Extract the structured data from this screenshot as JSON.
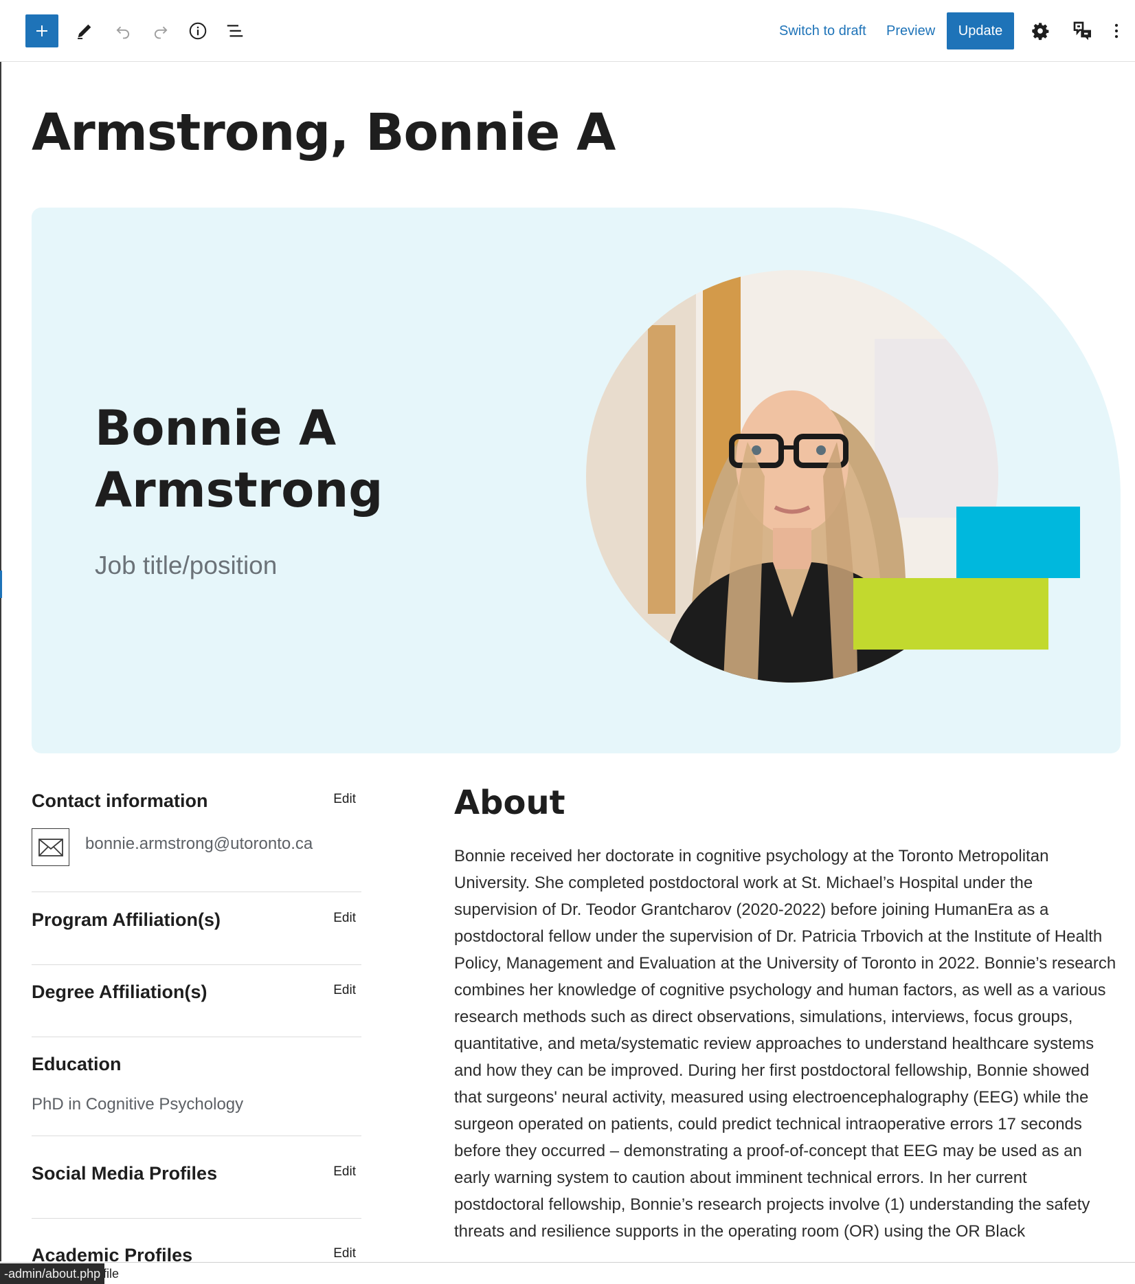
{
  "toolbar": {
    "add_block_icon": "plus-icon",
    "tools_icon": "pencil-icon",
    "undo_icon": "undo-icon",
    "redo_icon": "redo-icon",
    "details_icon": "info-icon",
    "list_view_icon": "list-view-icon",
    "switch_to_draft": "Switch to draft",
    "preview": "Preview",
    "update": "Update",
    "settings_icon": "gear-icon",
    "plugin_icon": "plugin-icon",
    "options_icon": "more-vertical-icon",
    "accent_color": "#1e73b8"
  },
  "post": {
    "title": "Armstrong, Bonnie A"
  },
  "hero": {
    "name": "Bonnie A Armstrong",
    "job_title_placeholder": "Job title/position",
    "background_color": "#e6f6fa",
    "accent_blue": "#00b8dd",
    "accent_green": "#c2d92e"
  },
  "sidebar": {
    "contact": {
      "heading": "Contact information",
      "edit": "Edit",
      "email_icon": "envelope-icon",
      "email": "bonnie.armstrong@utoronto.ca"
    },
    "program": {
      "heading": "Program Affiliation(s)",
      "edit": "Edit"
    },
    "degree": {
      "heading": "Degree Affiliation(s)",
      "edit": "Edit"
    },
    "education": {
      "heading": "Education",
      "value": "PhD in Cognitive Psychology"
    },
    "social": {
      "heading": "Social Media Profiles",
      "edit": "Edit"
    },
    "academic": {
      "heading": "Academic Profiles",
      "edit": "Edit"
    }
  },
  "about": {
    "heading": "About",
    "body": "Bonnie received her doctorate in cognitive psychology at the Toronto Metropolitan University. She completed postdoctoral work at St. Michael’s Hospital under the supervision of Dr. Teodor Grantcharov (2020-2022) before joining HumanEra as a postdoctoral fellow under the supervision of Dr. Patricia Trbovich at the Institute of Health Policy, Management and Evaluation at the University of Toronto in 2022. Bonnie’s research combines her knowledge of cognitive psychology and human factors, as well as a various research methods such as direct observations, simulations, interviews, focus groups, quantitative, and meta/systematic review approaches to understand healthcare systems and how they can be improved. During her first postdoctoral fellowship, Bonnie showed that surgeons' neural activity, measured using electroencephalography (EEG) while the surgeon operated on patients, could predict technical intraoperative errors 17 seconds before they occurred – demonstrating a proof-of-concept that EEG may be used as an early warning system to caution about imminent technical errors. In her current postdoctoral fellowship, Bonnie’s research projects involve (1) understanding the safety threats and resilience supports in the operating room (OR) using the OR Black"
  },
  "status_bar": {
    "url": "-admin/about.php",
    "trailing": "file"
  }
}
